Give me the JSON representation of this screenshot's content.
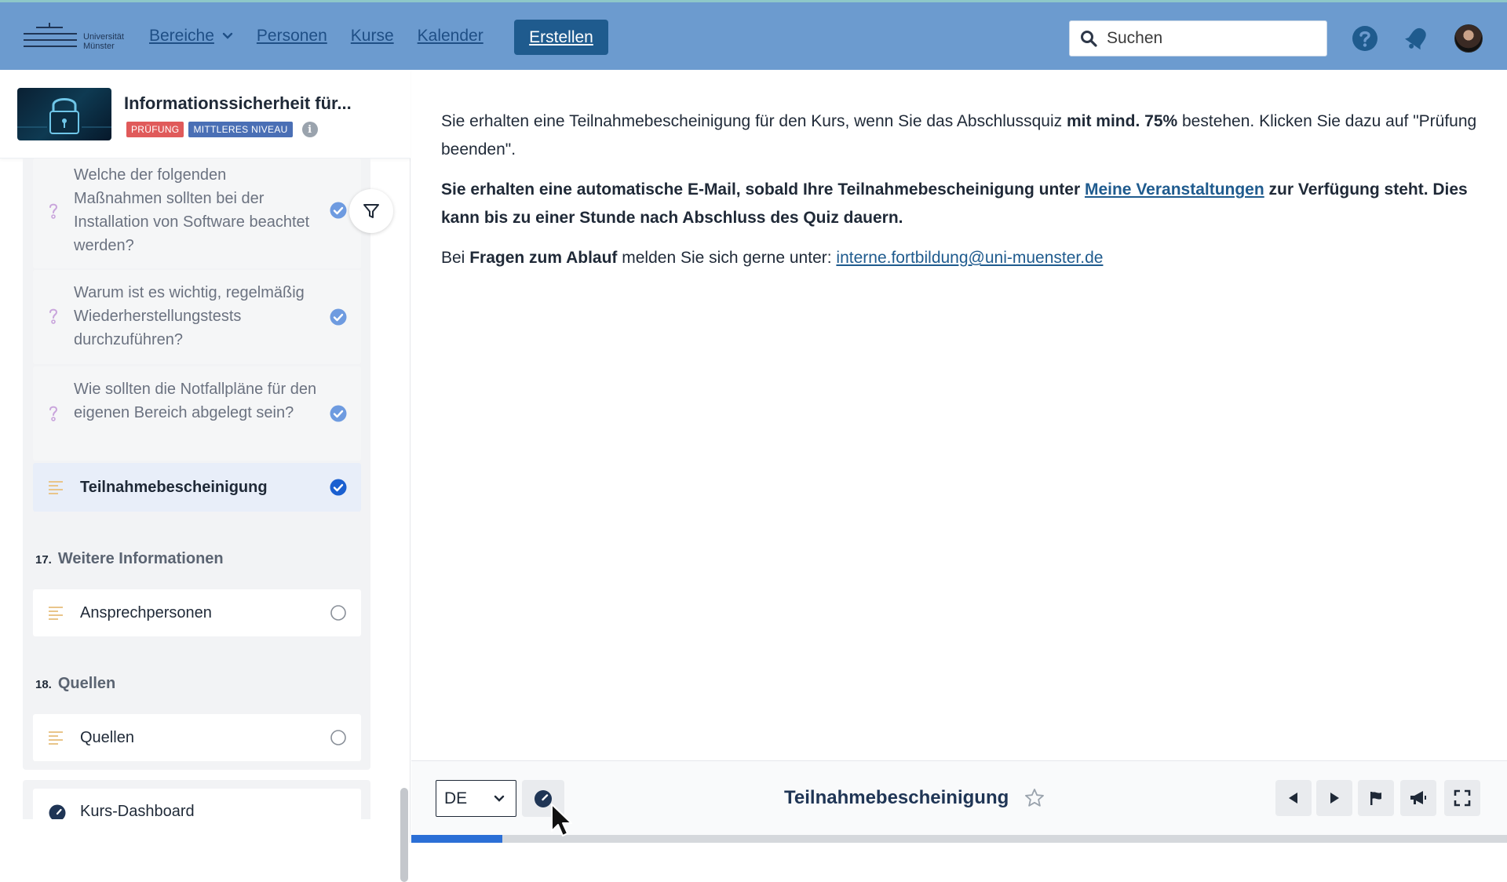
{
  "header": {
    "logo": {
      "line1": "Universität",
      "line2": "Münster"
    },
    "nav": [
      {
        "label": "Bereiche",
        "has_dropdown": true
      },
      {
        "label": "Personen"
      },
      {
        "label": "Kurse"
      },
      {
        "label": "Kalender"
      }
    ],
    "create_label": "Erstellen",
    "search": {
      "placeholder": "Suchen"
    },
    "icons": [
      "help-icon",
      "bell-icon",
      "avatar"
    ]
  },
  "sidebar": {
    "course": {
      "title": "Informationssicherheit für...",
      "badges": [
        "PRÜFUNG",
        "MITTLERES NIVEAU"
      ],
      "info_symbol": "i"
    },
    "items": [
      {
        "type": "question",
        "label": "Welche der folgenden Maßnahmen sollten bei der Installation von Software beachtet werden?",
        "done": true
      },
      {
        "type": "question",
        "label": "Warum ist es wichtig, regelmäßig Wiederherstellungstests durchzuführen?",
        "done": true
      },
      {
        "type": "question",
        "label": "Wie sollten die Notfallpläne für den eigenen Bereich abgelegt sein?",
        "done": true
      },
      {
        "type": "page",
        "label": "Teilnahmebescheinigung",
        "done": true,
        "active": true
      }
    ],
    "sections": [
      {
        "number": "17.",
        "title": "Weitere Informationen",
        "items": [
          {
            "label": "Ansprechpersonen",
            "done": false
          }
        ]
      },
      {
        "number": "18.",
        "title": "Quellen",
        "items": [
          {
            "label": "Quellen",
            "done": false
          }
        ]
      }
    ],
    "dashboard_label": "Kurs-Dashboard"
  },
  "main": {
    "p1": {
      "before": "Sie erhalten eine Teilnahmebescheinigung für den Kurs, wenn Sie das Abschlussquiz ",
      "bold": "mit mind. 75%",
      "after": " bestehen. Klicken Sie dazu auf \"Prüfung beenden\"."
    },
    "p2": {
      "before": "Sie erhalten eine automatische E-Mail, sobald Ihre Teilnahmebescheinigung unter ",
      "link": "Meine Veranstaltungen",
      "after": " zur Verfügung steht. Dies kann bis zu einer Stunde nach Abschluss des Quiz dauern."
    },
    "p3": {
      "before": "Bei ",
      "bold": "Fragen zum Ablauf",
      "middle": " melden Sie sich gerne unter: ",
      "email": "interne.fortbildung@uni-muenster.de"
    }
  },
  "footer": {
    "language": "DE",
    "title": "Teilnahmebescheinigung",
    "progress_fraction": 0.083,
    "controls": [
      "previous-icon",
      "next-icon",
      "flag-icon",
      "megaphone-icon",
      "fullscreen-icon"
    ]
  },
  "colors": {
    "topbar": "#6c9bcf",
    "create_button": "#1f5b8e",
    "link": "#1f5b8e",
    "check": "#2b6fd6",
    "check_muted": "#6e9be0",
    "badge_red": "#e05a5a",
    "badge_blue": "#4a6fb5"
  }
}
